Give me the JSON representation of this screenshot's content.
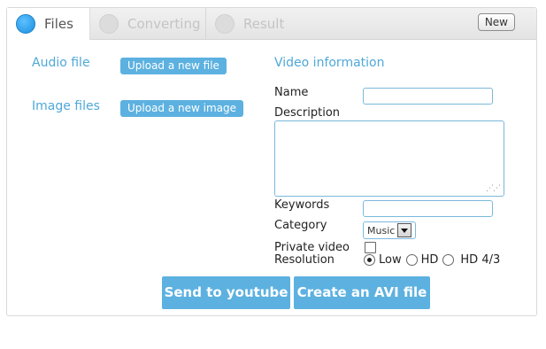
{
  "tabs": [
    {
      "label": "Files",
      "state": "active"
    },
    {
      "label": "Converting",
      "state": "inactive"
    },
    {
      "label": "Result",
      "state": "inactive"
    }
  ],
  "new_button": "New",
  "files": {
    "audio_label": "Audio file",
    "audio_button": "Upload a new file",
    "image_label": "Image files",
    "image_button": "Upload a new image"
  },
  "video_info": {
    "heading": "Video information",
    "name_label": "Name",
    "name_value": "",
    "description_label": "Description",
    "description_value": "",
    "keywords_label": "Keywords",
    "keywords_value": "",
    "category_label": "Category",
    "category_value": "Music",
    "private_label": "Private video",
    "private_checked": false,
    "resolution_label": "Resolution",
    "resolution_options": [
      "Low",
      "HD",
      "HD 4/3"
    ],
    "resolution_selected": "Low"
  },
  "actions": {
    "send": "Send to youtube",
    "create": "Create an AVI file"
  },
  "colors": {
    "accent": "#5cb1e0",
    "label_blue": "#4fa8d8",
    "active_dot": "#1a8fe0"
  }
}
